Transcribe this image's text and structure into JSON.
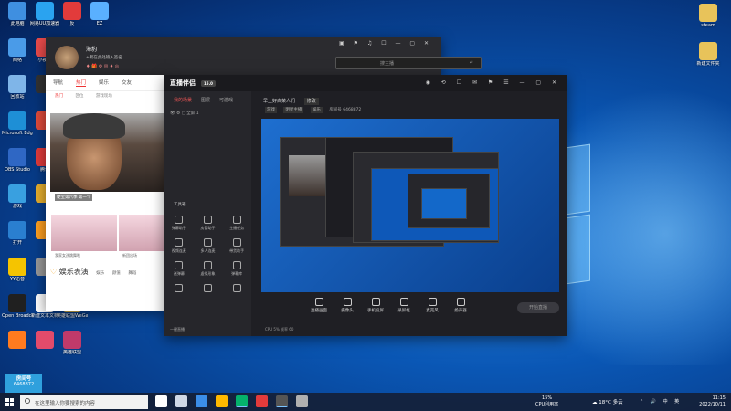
{
  "desktop": {
    "left_icons": [
      {
        "label": "此电脑",
        "color": "#3f8fe0"
      },
      {
        "label": "网易UU加速器",
        "color": "#2aa3f0"
      },
      {
        "label": "反",
        "color": "#e23b3b"
      },
      {
        "label": "EZ",
        "color": "#5ab0ff"
      },
      {
        "label": "网络",
        "color": "#4a9be8"
      },
      {
        "label": "小视频",
        "color": "#e94b4b"
      },
      {
        "label": "回收站",
        "color": "#7fb5e8"
      },
      {
        "label": "",
        "color": "#333"
      },
      {
        "label": "Microsoft Edge",
        "color": "#1e8fd6"
      },
      {
        "label": "",
        "color": "#e14b3b"
      },
      {
        "label": "OBS Studio",
        "color": "#2f67c4"
      },
      {
        "label": "腾讯",
        "color": "#e23b3b"
      },
      {
        "label": "游戏",
        "color": "#39a0e0"
      },
      {
        "label": "",
        "color": "#e8b02e"
      },
      {
        "label": "打开",
        "color": "#2a7fd0"
      },
      {
        "label": "",
        "color": "#ffa020"
      },
      {
        "label": "YY语音",
        "color": "#f5c400"
      },
      {
        "label": "",
        "color": "#999"
      },
      {
        "label": "Open Broadcaster",
        "color": "#202020"
      },
      {
        "label": "新建文本文档",
        "color": "#ffffff"
      },
      {
        "label": "英雄联盟WeGame版",
        "color": "#d8b24a"
      },
      {
        "label": "",
        "color": "#ff7b1f"
      },
      {
        "label": "",
        "color": "#e24b6b"
      },
      {
        "label": "英雄联盟",
        "color": "#c03a6a"
      }
    ],
    "right_icons": [
      {
        "label": "steam",
        "color": "#e8c35a"
      },
      {
        "label": "新建文件夹",
        "color": "#e8c35a"
      }
    ],
    "sticky": {
      "line1": "房间号",
      "line2": "6468872"
    }
  },
  "top_window": {
    "name": "海豹",
    "signature": "+聚在此处输入签名",
    "badges": "♦ 🎁 ⚙ ✉ ♦ ◎",
    "controls": "▣ ⚑ ♫ ☐ — ▢ ✕",
    "search_placeholder": "搜主播",
    "enter_icon": "↵"
  },
  "feed": {
    "tabs": [
      "导航",
      "热门",
      "娱乐",
      "交友"
    ],
    "active_tab": "热门",
    "subtabs": [
      "热门",
      "区位",
      "游戏现场"
    ],
    "hero_caption": "梗宝第六季 第一个",
    "hero_stats": "◎ 1295观众 ♥ 4673",
    "thumb1_caption": "我家女孩跳舞啦",
    "thumb2_caption": "新团出场",
    "section_title": "娱乐表演",
    "section_tabs": [
      "娱乐",
      "颜值",
      "舞蹈"
    ]
  },
  "studio": {
    "logo": "直播伴侣",
    "version": "15.0",
    "avatar_color": "#c2956a",
    "left_tabs": [
      "我的场景",
      "图层",
      "可游戏"
    ],
    "scene_label": "全屏 1",
    "tools_title": "工具箱",
    "tools": [
      "弹幕助手",
      "房管助手",
      "主播任务",
      "视频连麦",
      "多人连麦",
      "带货助手",
      "送弹幕",
      "虚拟形象",
      "弹幕库",
      "",
      "",
      ""
    ],
    "footer": "一键直播",
    "room_title": "早上好白某人们",
    "room_edit": "修改",
    "room_tags": [
      "游戏",
      "明星主播",
      "娱乐"
    ],
    "room_id_text": "房间号 6468872",
    "bottom_buttons": [
      "直播画面",
      "摄像头",
      "手机投屏",
      "录屏框",
      "麦克风",
      "扬声器"
    ],
    "go_live": "开始直播",
    "status": "CPU 5% 帧率 60"
  },
  "taskbar": {
    "search_placeholder": "在这里输入你要搜索的内容",
    "cpu_line1": "15%",
    "cpu_line2": "CPU利用率",
    "weather": "☁ 18°C 多云",
    "tray_icons": "⌃ 🔊 中 英",
    "time": "11:15",
    "date": "2022/10/11",
    "app_colors": [
      "#ffffff",
      "#cfd8e6",
      "#3b8ee8",
      "#ffb900",
      "#05b26b",
      "#e33b3b",
      "#555",
      "#b0b0b0"
    ]
  }
}
